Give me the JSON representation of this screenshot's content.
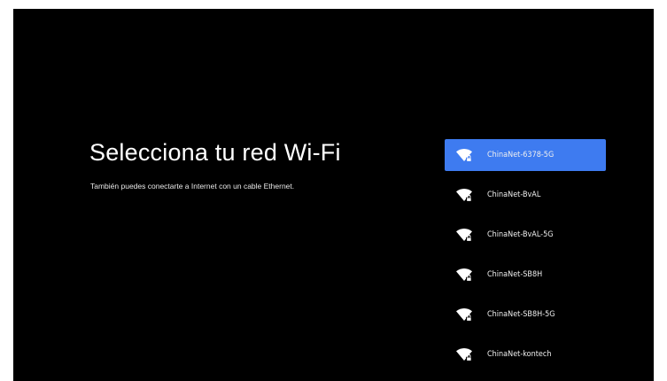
{
  "page": {
    "title": "Selecciona tu red Wi-Fi",
    "subtitle": "También puedes conectarte a Internet con un cable Ethernet."
  },
  "networks": [
    {
      "name": "ChinaNet-6378-5G",
      "icon": "wifi-locked-icon",
      "selected": true
    },
    {
      "name": "ChinaNet-BvAL",
      "icon": "wifi-locked-icon",
      "selected": false
    },
    {
      "name": "ChinaNet-BvAL-5G",
      "icon": "wifi-locked-icon",
      "selected": false
    },
    {
      "name": "ChinaNet-SB8H",
      "icon": "wifi-locked-icon",
      "selected": false
    },
    {
      "name": "ChinaNet-SB8H-5G",
      "icon": "wifi-locked-icon",
      "selected": false
    },
    {
      "name": "ChinaNet-kontech",
      "icon": "wifi-locked-icon",
      "selected": false
    }
  ],
  "colors": {
    "background": "#000000",
    "selected": "#3e7bf0",
    "text": "#ffffff"
  }
}
